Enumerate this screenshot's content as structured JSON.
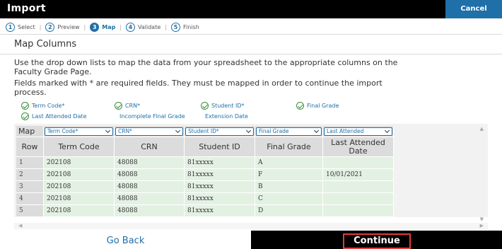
{
  "header": {
    "title": "Import",
    "cancel_label": "Cancel"
  },
  "steps": [
    {
      "num": "1",
      "label": "Select"
    },
    {
      "num": "2",
      "label": "Preview"
    },
    {
      "num": "3",
      "label": "Map"
    },
    {
      "num": "4",
      "label": "Validate"
    },
    {
      "num": "5",
      "label": "Finish"
    }
  ],
  "section": {
    "title": "Map Columns",
    "instruction_1_line_1": "Use the drop down lists to map the data from your spreadsheet to the appropriate columns on the",
    "instruction_1_line_2": "Faculty Grade Page.",
    "instruction_2_line_1": "Fields marked with * are required fields. They must be mapped in order to continue the import",
    "instruction_2_line_2": "process."
  },
  "legend": {
    "term_code": "Term Code*",
    "crn": "CRN*",
    "student_id": "Student ID*",
    "final_grade": "Final Grade",
    "last_attended": "Last Attended Date",
    "incomplete_final": "Incomplete Final Grade",
    "extension_date": "Extension Date"
  },
  "grid": {
    "map_label": "Map",
    "selects": [
      "Term Code*",
      "CRN*",
      "Student ID*",
      "Final Grade",
      "Last Attended"
    ],
    "headers": [
      "Row",
      "Term Code",
      "CRN",
      "Student ID",
      "Final Grade",
      "Last Attended\nDate"
    ],
    "rows": [
      [
        "1",
        "202108",
        "48088",
        "81xxxxx",
        "A",
        ""
      ],
      [
        "2",
        "202108",
        "48088",
        "81xxxxx",
        "F",
        "10/01/2021"
      ],
      [
        "3",
        "202108",
        "48088",
        "81xxxxx",
        "B",
        ""
      ],
      [
        "4",
        "202108",
        "48088",
        "81xxxxx",
        "C",
        ""
      ],
      [
        "5",
        "202108",
        "48088",
        "81xxxxx",
        "D",
        ""
      ]
    ]
  },
  "footer": {
    "back_label": "Go Back",
    "continue_label": "Continue"
  }
}
